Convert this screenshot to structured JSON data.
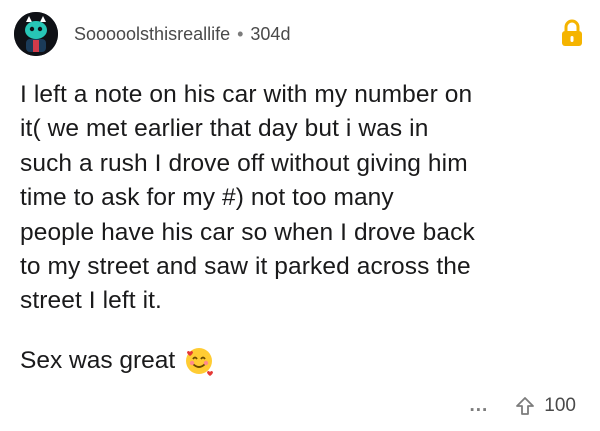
{
  "post": {
    "username": "Soooools​thisreallife",
    "age": "304d",
    "separator": "•",
    "lines": [
      "I left a note on his car with my number on",
      "it( we met earlier that day but i was in",
      "such a rush I drove off without giving him",
      "time to ask for my #) not too many",
      "people have his car so when I drove back",
      "to my street and saw it parked across the",
      "street I left it."
    ],
    "followup": "Sex was great",
    "more_label": "...",
    "upvotes": "100"
  },
  "colors": {
    "lock": "#f5b400",
    "avatar_bg": "#0f1116",
    "avatar_accent": "#27c6b6"
  },
  "icons": {
    "lock": "lock-icon",
    "upvote": "upvote-arrow-icon",
    "emoji": "smiling-face-with-hearts-icon"
  }
}
